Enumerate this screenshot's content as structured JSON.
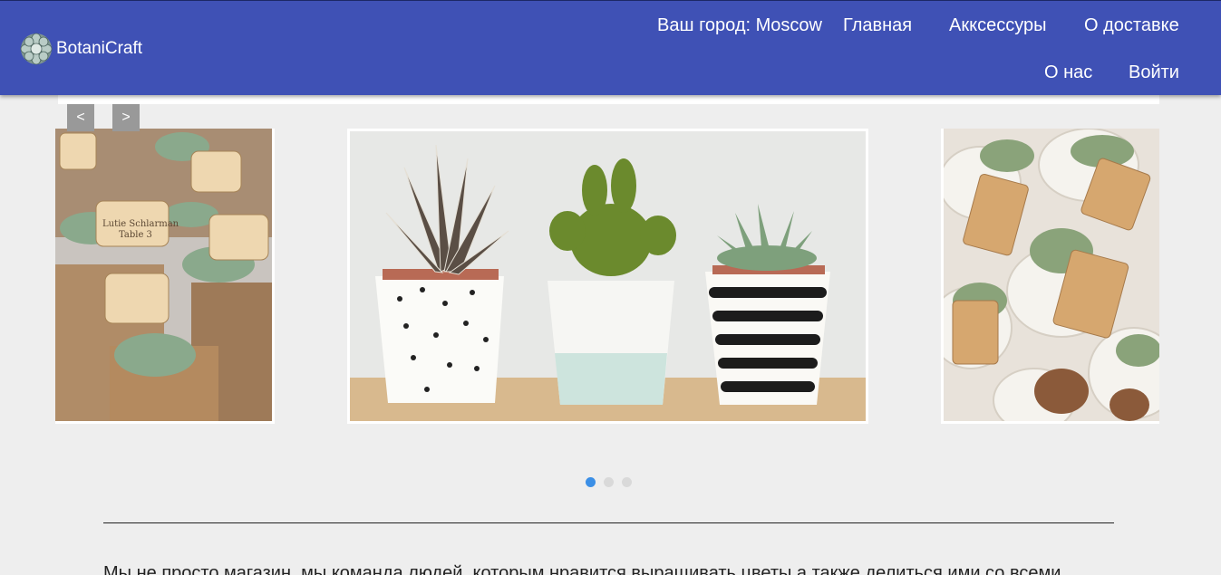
{
  "brand": {
    "name": "BotaniCraft",
    "logo_icon": "succulent-logo-icon"
  },
  "colors": {
    "header_bg": "#3f51b5",
    "page_bg": "#eeeeee",
    "dot_active": "#3b8fe6",
    "dot_inactive": "#d9d9d9",
    "arrow_bg": "#999999"
  },
  "nav": {
    "city": "Ваш город: Moscow",
    "items": [
      "Главная",
      "Акксессуры",
      "О доставке",
      "О нас",
      "Войти"
    ]
  },
  "carousel": {
    "prev_label": "<",
    "next_label": ">",
    "slides": [
      {
        "description": "succulents-with-name-cards"
      },
      {
        "description": "three-succulents-in-painted-pots"
      },
      {
        "description": "succulent-favors-with-tags"
      }
    ],
    "active_index": 0
  },
  "about": {
    "text": "Мы не просто магазин, мы команда людей, которым нравится выращивать цветы а также делиться ими со всеми"
  }
}
